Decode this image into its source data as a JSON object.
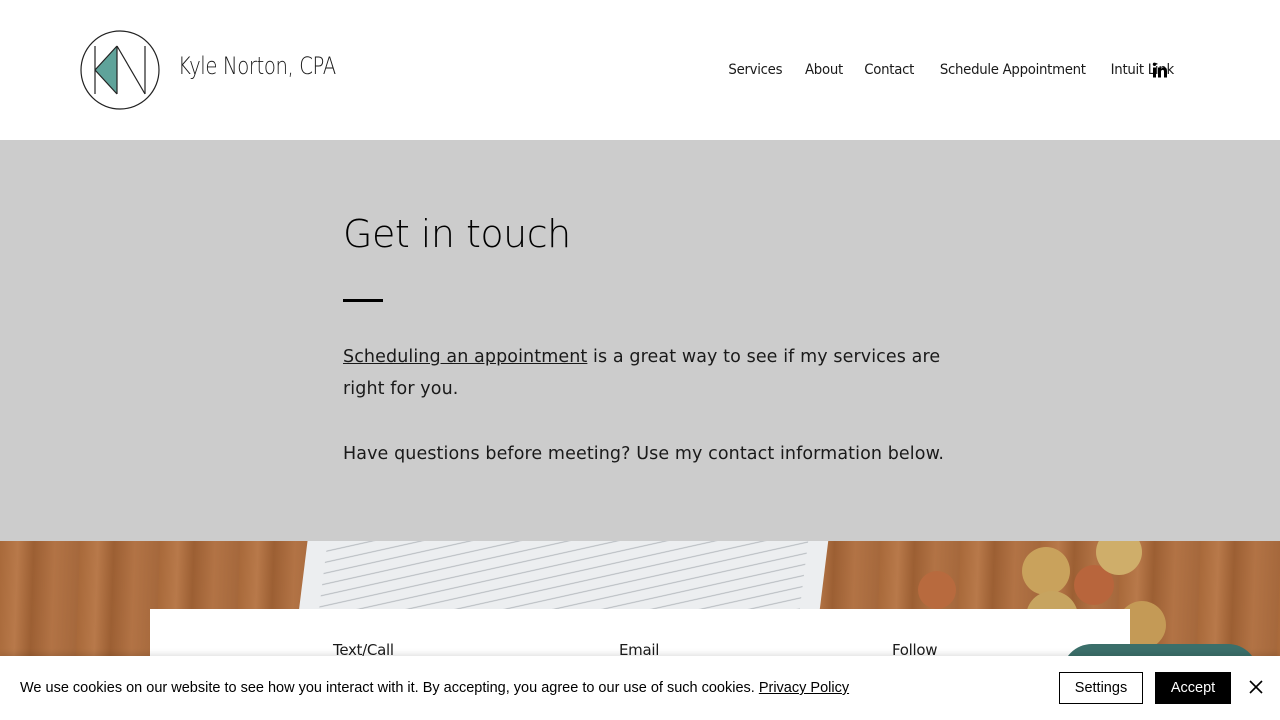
{
  "header": {
    "brand": "Kyle Norton, CPA",
    "nav": [
      "Services",
      "About",
      "Contact",
      "Schedule Appointment",
      "Intuit Link"
    ],
    "social_icon": "linkedin-icon"
  },
  "hero": {
    "title": "Get in touch",
    "link_text": "Scheduling an appointment",
    "p1_rest": " is a great way to see if my services are right for you.",
    "p2": "Have questions before meeting? Use my contact information below."
  },
  "info": {
    "col1": "Text/Call",
    "col2": "Email",
    "col3": "Follow"
  },
  "cookie": {
    "text": "We use cookies on our website to see how you interact with it. By accepting, you agree to our use of such cookies. ",
    "policy_link": "Privacy Policy",
    "settings_label": "Settings",
    "accept_label": "Accept"
  },
  "colors": {
    "hero_bg": "#cccccc",
    "logo_teal": "#5fa39a",
    "chat_teal": "#3b6f6a",
    "accept_bg": "#000000"
  }
}
